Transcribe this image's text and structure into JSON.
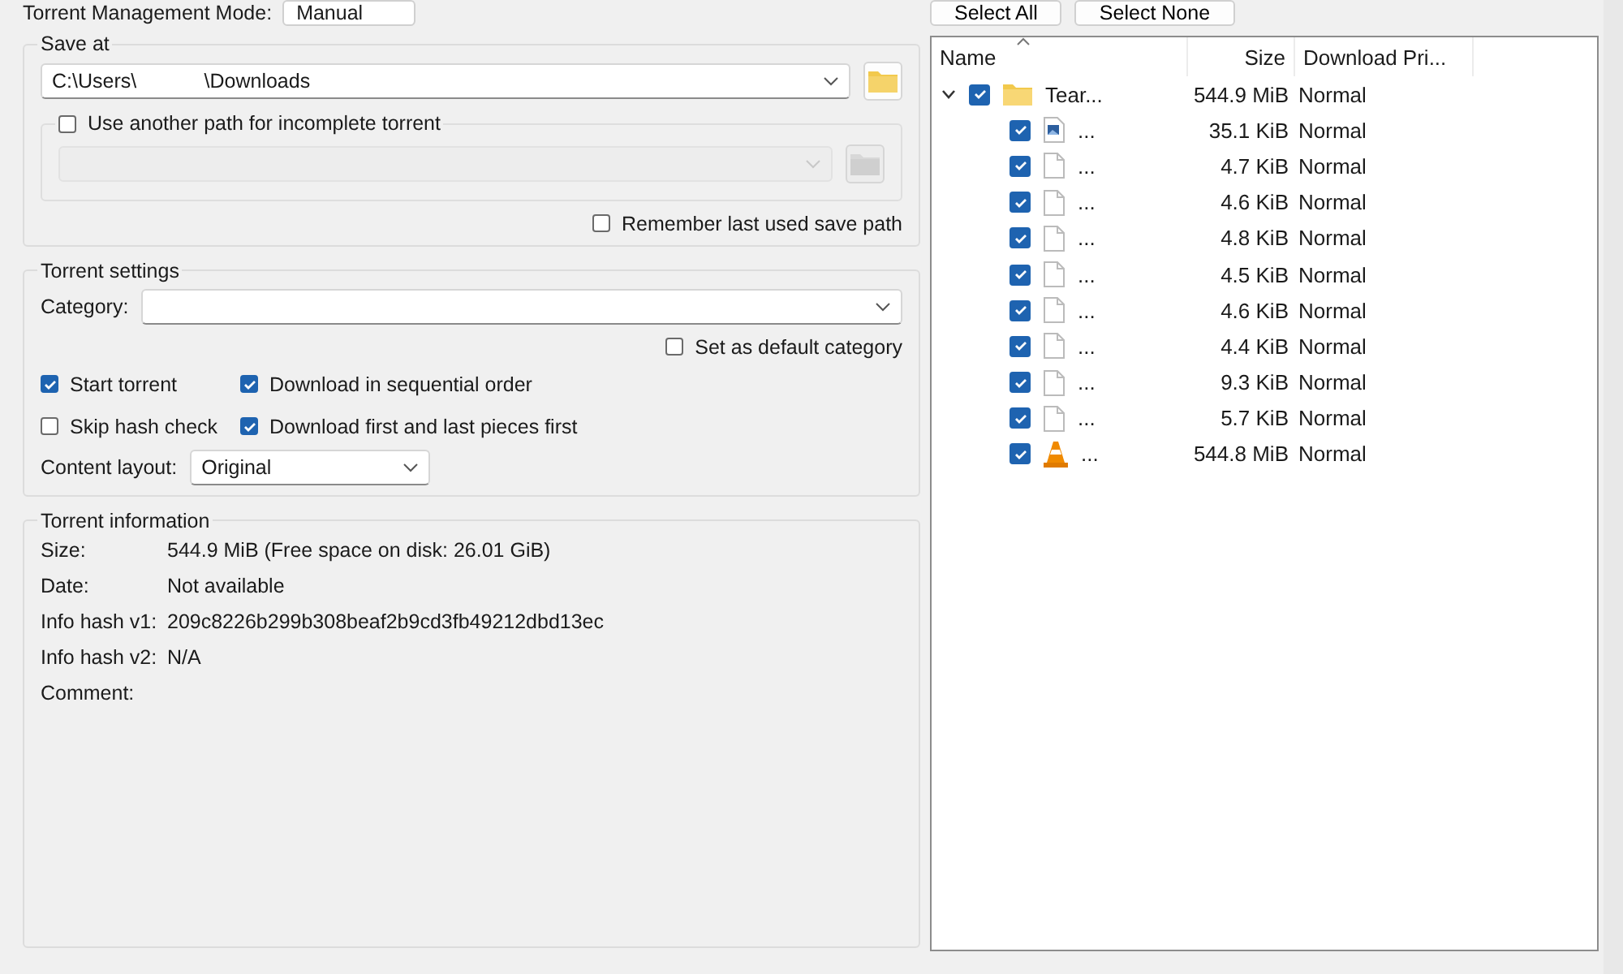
{
  "management_mode": {
    "label": "Torrent Management Mode:",
    "value": "Manual"
  },
  "save_at": {
    "title": "Save at",
    "path": "C:\\Users\\            \\Downloads",
    "incomplete": {
      "label": "Use another path for incomplete torrent",
      "checked": false
    },
    "remember": {
      "label": "Remember last used save path",
      "checked": false
    }
  },
  "torrent_settings": {
    "title": "Torrent settings",
    "category_label": "Category:",
    "default_category": {
      "label": "Set as default category",
      "checked": false
    },
    "options": [
      {
        "label": "Start torrent",
        "checked": true
      },
      {
        "label": "Download in sequential order",
        "checked": true
      },
      {
        "label": "Skip hash check",
        "checked": false
      },
      {
        "label": "Download first and last pieces first",
        "checked": true
      }
    ],
    "content_layout": {
      "label": "Content layout:",
      "value": "Original"
    }
  },
  "torrent_information": {
    "title": "Torrent information",
    "rows": [
      {
        "label": "Size:",
        "value": "544.9 MiB (Free space on disk: 26.01 GiB)"
      },
      {
        "label": "Date:",
        "value": "Not available"
      },
      {
        "label": "Info hash v1:",
        "value": "209c8226b299b308beaf2b9cd3fb49212dbd13ec"
      },
      {
        "label": "Info hash v2:",
        "value": "N/A"
      },
      {
        "label": "Comment:"
      }
    ]
  },
  "file_buttons": [
    "Select All",
    "Select None"
  ],
  "file_table": {
    "columns": [
      "Name",
      "Size",
      "Download Pri..."
    ],
    "rows": [
      {
        "name": "Tear...",
        "kind": "folder",
        "size": "544.9 MiB",
        "priority": "Normal",
        "checked": true,
        "expanded": true,
        "children": [
          {
            "name": "...",
            "kind": "image",
            "size": "35.1 KiB",
            "priority": "Normal",
            "checked": true
          },
          {
            "name": "...",
            "kind": "file",
            "size": "4.7 KiB",
            "priority": "Normal",
            "checked": true
          },
          {
            "name": "...",
            "kind": "file",
            "size": "4.6 KiB",
            "priority": "Normal",
            "checked": true
          },
          {
            "name": "...",
            "kind": "file",
            "size": "4.8 KiB",
            "priority": "Normal",
            "checked": true
          },
          {
            "name": "...",
            "kind": "file",
            "size": "4.5 KiB",
            "priority": "Normal",
            "checked": true
          },
          {
            "name": "...",
            "kind": "file",
            "size": "4.6 KiB",
            "priority": "Normal",
            "checked": true
          },
          {
            "name": "...",
            "kind": "file",
            "size": "4.4 KiB",
            "priority": "Normal",
            "checked": true
          },
          {
            "name": "...",
            "kind": "file",
            "size": "9.3 KiB",
            "priority": "Normal",
            "checked": true
          },
          {
            "name": "...",
            "kind": "file",
            "size": "5.7 KiB",
            "priority": "Normal",
            "checked": true
          },
          {
            "name": "...",
            "kind": "media",
            "size": "544.8 MiB",
            "priority": "Normal",
            "checked": true
          }
        ]
      }
    ]
  }
}
